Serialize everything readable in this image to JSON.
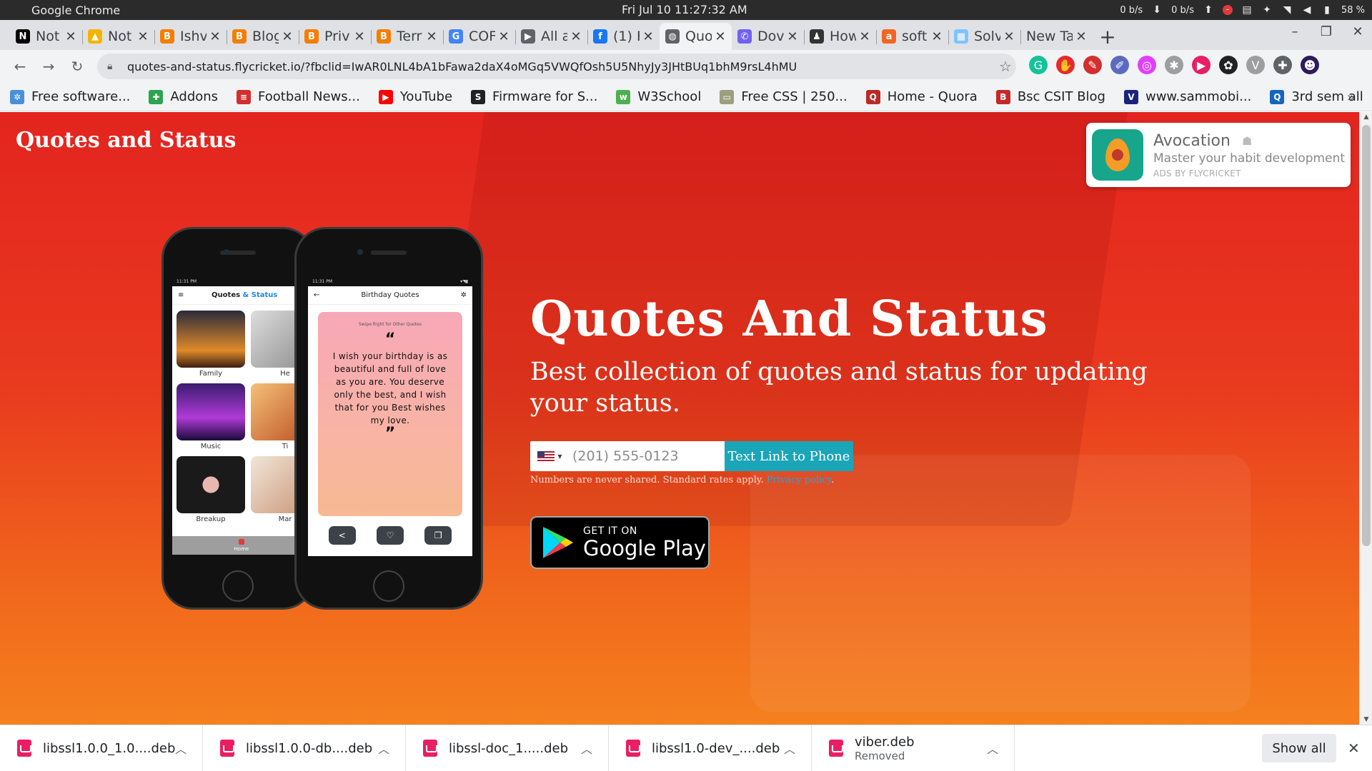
{
  "os": {
    "app_name": "Google Chrome",
    "clock": "Fri Jul 10  11:27:32 AM",
    "net_down": "0 b/s",
    "net_up": "0 b/s",
    "battery": "58 %"
  },
  "tabs": [
    {
      "title": "Not",
      "icon": "notion-icon",
      "color": "#000000",
      "glyph": "N"
    },
    {
      "title": "Not",
      "icon": "drive-icon",
      "color": "#f4b400",
      "glyph": "▲"
    },
    {
      "title": "Ishv",
      "icon": "blogger-icon",
      "color": "#f57d00",
      "glyph": "B"
    },
    {
      "title": "Blog",
      "icon": "blogger-icon",
      "color": "#f57d00",
      "glyph": "B"
    },
    {
      "title": "Priv",
      "icon": "blogger-icon",
      "color": "#f57d00",
      "glyph": "B"
    },
    {
      "title": "Terr",
      "icon": "blogger-icon",
      "color": "#f57d00",
      "glyph": "B"
    },
    {
      "title": "COF",
      "icon": "google-icon",
      "color": "#4285f4",
      "glyph": "G"
    },
    {
      "title": "All a",
      "icon": "play-console-icon",
      "color": "#5f6368",
      "glyph": "▶"
    },
    {
      "title": "(1) F",
      "icon": "facebook-icon",
      "color": "#1877f2",
      "glyph": "f"
    },
    {
      "title": "Quo",
      "icon": "globe-icon",
      "color": "#5f6368",
      "glyph": "◍",
      "active": true
    },
    {
      "title": "Dov",
      "icon": "viber-icon",
      "color": "#7360f2",
      "glyph": "✆"
    },
    {
      "title": "How",
      "icon": "linux-icon",
      "color": "#333333",
      "glyph": "♟"
    },
    {
      "title": "soft",
      "icon": "ask-icon",
      "color": "#f26522",
      "glyph": "a"
    },
    {
      "title": "Solv",
      "icon": "site-icon",
      "color": "#7fc3ff",
      "glyph": "▦"
    },
    {
      "title": "New Ta",
      "icon": "",
      "color": "",
      "glyph": ""
    }
  ],
  "address": {
    "url": "quotes-and-status.flycricket.io/?fbclid=IwAR0LNL4bA1bFawa2daX4oMGq5VWQfOsh5U5NhyJy3JHtBUq1bhM9rsL4hMU"
  },
  "extensions": [
    {
      "name": "grammarly-icon",
      "color": "#15c39a",
      "glyph": "G"
    },
    {
      "name": "adblock-icon",
      "color": "#e52b2b",
      "glyph": "✋"
    },
    {
      "name": "pdf-icon",
      "color": "#d32f2f",
      "glyph": "✎"
    },
    {
      "name": "eyedropper-icon",
      "color": "#5c6bc0",
      "glyph": "✐"
    },
    {
      "name": "color-icon",
      "color": "#e040fb",
      "glyph": "◎"
    },
    {
      "name": "bug-icon",
      "color": "#9e9e9e",
      "glyph": "✱"
    },
    {
      "name": "video-icon",
      "color": "#e91e63",
      "glyph": "▶"
    },
    {
      "name": "tampermonkey-icon",
      "color": "#222222",
      "glyph": "✿"
    },
    {
      "name": "vue-icon",
      "color": "#9e9e9e",
      "glyph": "V"
    },
    {
      "name": "puzzle-icon",
      "color": "#5f6368",
      "glyph": "✚"
    },
    {
      "name": "profile-avatar",
      "color": "#2d1b5e",
      "glyph": "☻"
    }
  ],
  "bookmarks": [
    {
      "label": "Free software...",
      "icon": "gear-icon",
      "color": "#4a90d9",
      "glyph": "✲"
    },
    {
      "label": "Addons",
      "icon": "puzzle-icon",
      "color": "#2ea44f",
      "glyph": "✚"
    },
    {
      "label": "Football News...",
      "icon": "news-icon",
      "color": "#d32f2f",
      "glyph": "≡"
    },
    {
      "label": "YouTube",
      "icon": "youtube-icon",
      "color": "#ff0000",
      "glyph": "▶"
    },
    {
      "label": "Firmware for S...",
      "icon": "s-icon",
      "color": "#222222",
      "glyph": "S"
    },
    {
      "label": "W3School",
      "icon": "w3-icon",
      "color": "#4caf50",
      "glyph": "w"
    },
    {
      "label": "Free CSS | 250...",
      "icon": "css-icon",
      "color": "#9e9e7e",
      "glyph": "▭"
    },
    {
      "label": "Home - Quora",
      "icon": "quora-icon",
      "color": "#b92b27",
      "glyph": "Q"
    },
    {
      "label": "Bsc CSIT Blog",
      "icon": "blog-icon",
      "color": "#c62828",
      "glyph": "B"
    },
    {
      "label": "www.sammobi...",
      "icon": "sammobile-icon",
      "color": "#1a237e",
      "glyph": "V"
    },
    {
      "label": "3rd sem all",
      "icon": "doc-icon",
      "color": "#1565c0",
      "glyph": "Q"
    }
  ],
  "site": {
    "brand": "Quotes and Status",
    "hero_title": "Quotes And Status",
    "hero_subtitle": "Best collection of quotes and status for updating your status.",
    "phone_placeholder": "(201) 555-0123",
    "send_button": "Text Link to Phone",
    "fineprint": "Numbers are never shared. Standard rates apply.",
    "privacy_link": "Privacy policy",
    "fineprint_end": ".",
    "gplay_top": "GET IT ON",
    "gplay_bottom": "Google Play"
  },
  "ad": {
    "title": "Avocation",
    "subtitle": "Master your habit development",
    "by": "ADS BY FLYCRICKET"
  },
  "phone_left": {
    "status_time": "11:31 PM",
    "title_a": "Quotes",
    "title_amp": " & ",
    "title_b": "Status",
    "categories": [
      {
        "label": "Family",
        "bg": "linear-gradient(180deg,#2a2a3a 0%,#e08a2a 70%,#3a2010 100%)"
      },
      {
        "label": "He",
        "bg": "linear-gradient(135deg,#ddd 0%,#888 100%)"
      },
      {
        "label": "Music",
        "bg": "linear-gradient(180deg,#3a1c6e 0%,#b03ad8 60%,#1a0a3a 100%)"
      },
      {
        "label": "Ti",
        "bg": "linear-gradient(135deg,#f5c07a 0%,#b84a1a 100%)"
      },
      {
        "label": "Breakup",
        "bg": "radial-gradient(circle at 50% 50%,#e8b8b0 0 18%,#1a1a1a 19% 100%)"
      },
      {
        "label": "Mar",
        "bg": "linear-gradient(135deg,#f1e6d8 0%,#c89070 100%)"
      }
    ],
    "nav_label": "Home"
  },
  "phone_right": {
    "status_time": "11:31 PM",
    "title": "Birthday Quotes",
    "swipe_hint": "Swipe Right for Other Quotes",
    "quote": "I wish your birthday is as beautiful and full of love as you are. You deserve only the best, and I wish that for you Best wishes my love.",
    "actions": [
      "share-icon",
      "heart-icon",
      "copy-icon"
    ]
  },
  "downloads": [
    {
      "name": "libssl1.0.0_1.0....deb",
      "status": ""
    },
    {
      "name": "libssl1.0.0-db....deb",
      "status": ""
    },
    {
      "name": "libssl-doc_1.....deb",
      "status": ""
    },
    {
      "name": "libssl1.0-dev_....deb",
      "status": ""
    },
    {
      "name": "viber.deb",
      "status": "Removed"
    }
  ],
  "shelf": {
    "show_all": "Show all"
  }
}
